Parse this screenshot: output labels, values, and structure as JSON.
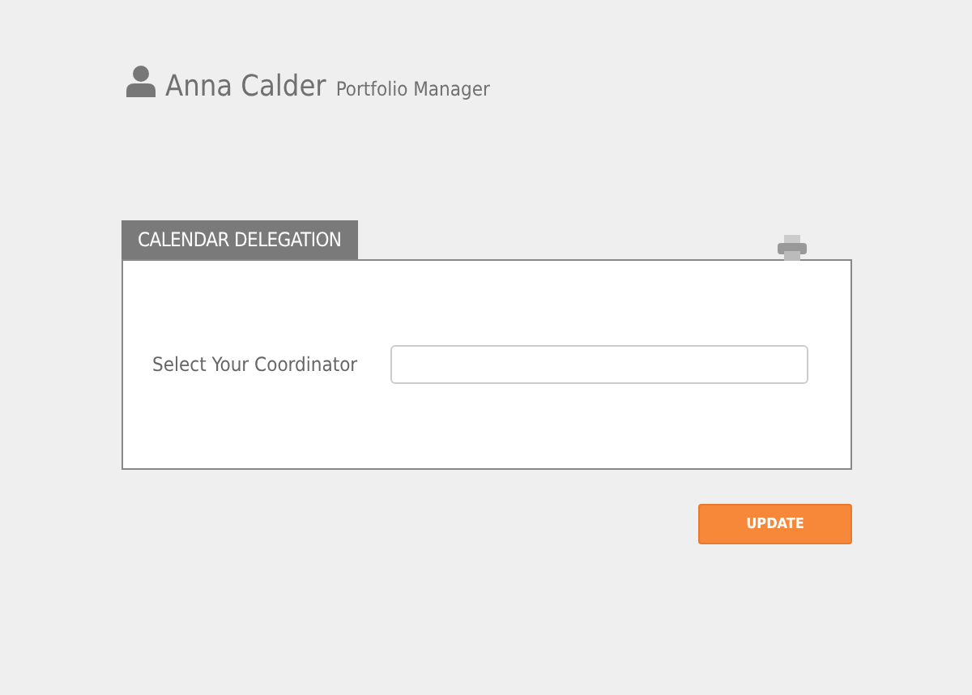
{
  "user": {
    "name": "Anna Calder",
    "role": "Portfolio Manager"
  },
  "panel": {
    "title": "CALENDAR DELEGATION",
    "field": {
      "label": "Select Your Coordinator"
    }
  },
  "buttons": [
    {
      "label": "UPDATE"
    }
  ]
}
